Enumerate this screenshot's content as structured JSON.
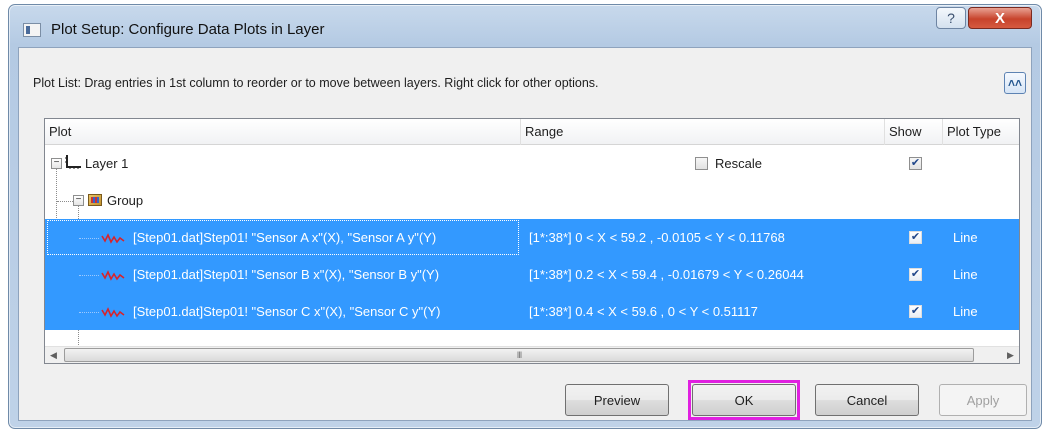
{
  "window": {
    "title": "Plot Setup: Configure Data Plots in Layer",
    "help_glyph": "?",
    "close_glyph": "X"
  },
  "instruction": "Plot List: Drag entries in 1st column to reorder or to move between layers. Right click for other options.",
  "collapse_glyph": "˄˄",
  "columns": {
    "plot": "Plot",
    "range": "Range",
    "show": "Show",
    "plot_type": "Plot Type"
  },
  "tree": {
    "layer": {
      "label": "Layer 1",
      "rescale_label": "Rescale",
      "rescale_checked": false,
      "show_checked": true
    },
    "group": {
      "label": "Group"
    },
    "plots": [
      {
        "name": "[Step01.dat]Step01! \"Sensor A x\"(X), \"Sensor A y\"(Y)",
        "range": "[1*:38*]  0 < X < 59.2 , -0.0105 < Y < 0.11768",
        "show": true,
        "plot_type": "Line"
      },
      {
        "name": "[Step01.dat]Step01! \"Sensor B x\"(X), \"Sensor B y\"(Y)",
        "range": "[1*:38*]  0.2 < X < 59.4 , -0.01679 < Y < 0.26044",
        "show": true,
        "plot_type": "Line"
      },
      {
        "name": "[Step01.dat]Step01! \"Sensor C x\"(X), \"Sensor C y\"(Y)",
        "range": "[1*:38*]  0.4 < X < 59.6 , 0 < Y < 0.51117",
        "show": true,
        "plot_type": "Line"
      }
    ]
  },
  "scrollbar": {
    "grip": "III"
  },
  "buttons": {
    "preview": "Preview",
    "ok": "OK",
    "cancel": "Cancel",
    "apply": "Apply"
  },
  "colors": {
    "selection": "#3399ff",
    "ok_highlight": "#e020e0",
    "plot_line_icon": "#d9232a"
  },
  "icons": {
    "layer": "layer-axes-icon",
    "group": "group-icon",
    "plot": "line-plot-icon",
    "checkmark": "✔"
  }
}
